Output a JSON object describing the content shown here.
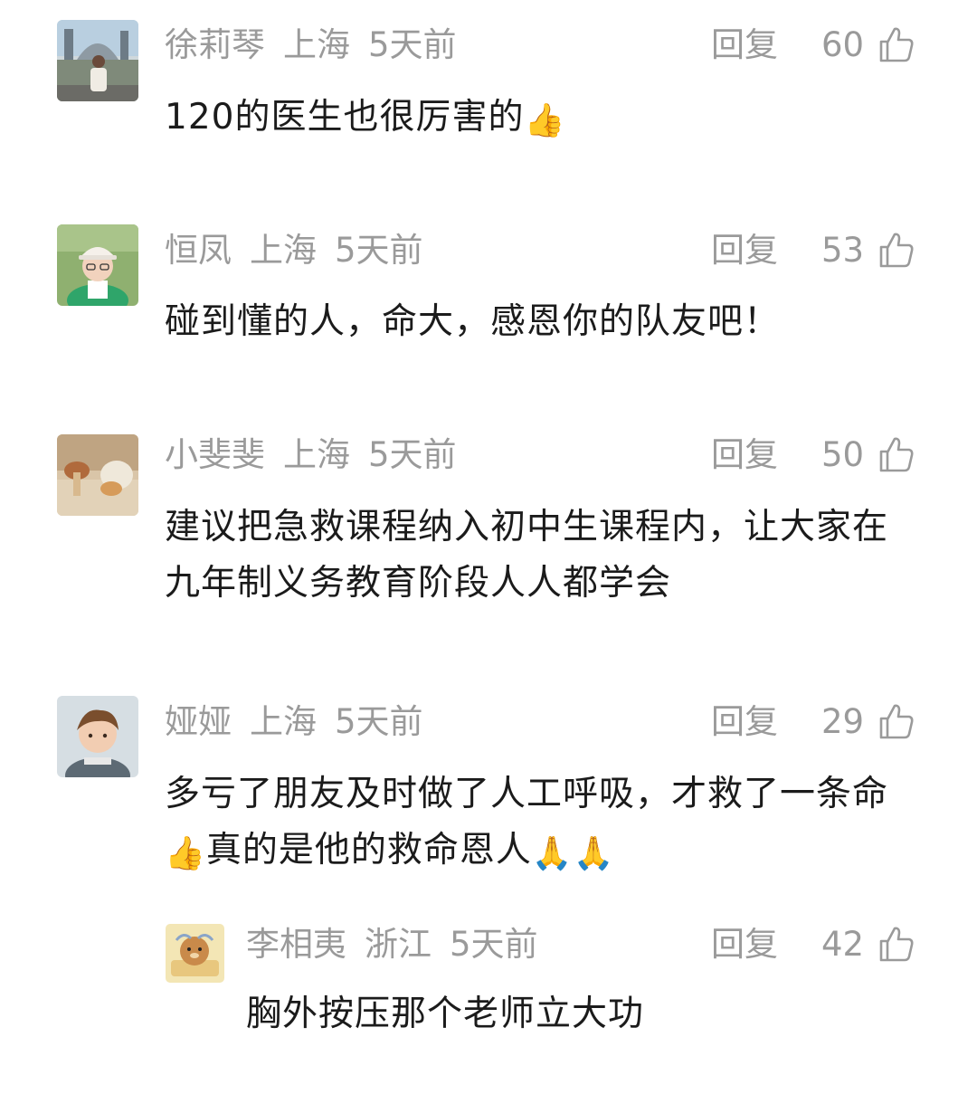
{
  "comments": [
    {
      "username": "徐莉琴",
      "location": "上海",
      "time": "5天前",
      "reply_label": "回复",
      "likes": "60",
      "text": "120的医生也很厉害的",
      "emoji": "👍"
    },
    {
      "username": "恒凤",
      "location": "上海",
      "time": "5天前",
      "reply_label": "回复",
      "likes": "53",
      "text": "碰到懂的人，命大，感恩你的队友吧！"
    },
    {
      "username": "小斐斐",
      "location": "上海",
      "time": "5天前",
      "reply_label": "回复",
      "likes": "50",
      "text": "建议把急救课程纳入初中生课程内，让大家在九年制义务教育阶段人人都学会"
    },
    {
      "username": "娅娅",
      "location": "上海",
      "time": "5天前",
      "reply_label": "回复",
      "likes": "29",
      "text_part1": "多亏了朋友及时做了人工呼吸，才救了一条命",
      "emoji1": "👍",
      "text_part2": "真的是他的救命恩人",
      "emoji2": "🙏🙏"
    }
  ],
  "reply": {
    "username": "李相夷",
    "location": "浙江",
    "time": "5天前",
    "reply_label": "回复",
    "likes": "42",
    "text": "胸外按压那个老师立大功"
  },
  "icons": {
    "like": "thumbs-up-outline-icon"
  }
}
